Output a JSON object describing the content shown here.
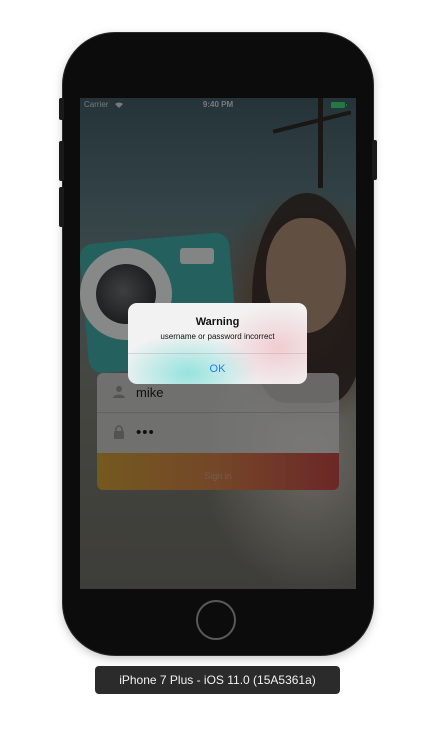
{
  "status_bar": {
    "carrier": "Carrier",
    "time": "9:40 PM",
    "wifi_icon": "wifi-icon",
    "battery_icon": "battery-icon",
    "battery_color": "#3cd070"
  },
  "login": {
    "username": "mike",
    "password_masked": "•••",
    "user_icon": "person-icon",
    "lock_icon": "lock-icon",
    "sign_in_label": "Sign in",
    "sign_in_gradient": [
      "#c89a36",
      "#c77a46",
      "#bb4444"
    ]
  },
  "alert": {
    "title": "Warning",
    "message": "username or password incorrect",
    "ok_label": "OK",
    "ok_color": "#1d7ff0"
  },
  "device": {
    "label": "iPhone 7 Plus - iOS 11.0 (15A5361a)"
  }
}
